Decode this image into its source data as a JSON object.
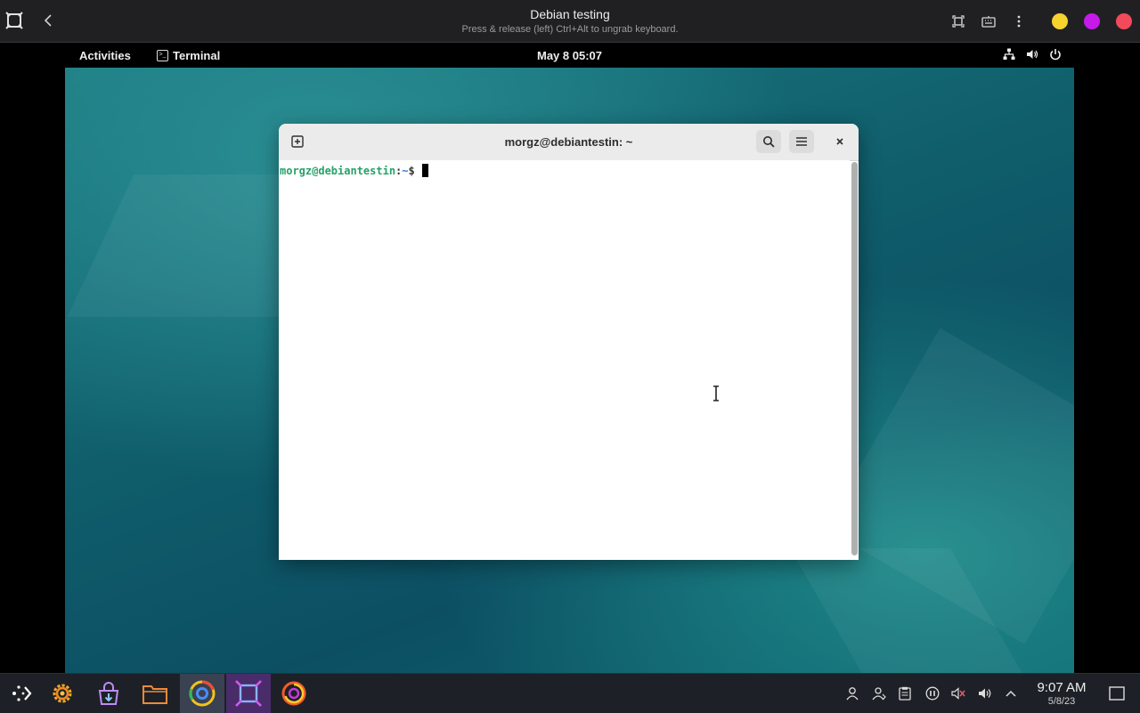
{
  "host": {
    "title": "Debian testing",
    "subtitle": "Press & release (left) Ctrl+Alt to ungrab keyboard.",
    "icons": {
      "app": "app-frame-icon",
      "back": "back-arrow-icon",
      "fit": "fit-window-icon",
      "keyboard": "keyboard-icon",
      "more": "more-vertical-icon"
    },
    "dots": [
      {
        "name": "yellow-dot",
        "color": "#f6d32d"
      },
      {
        "name": "purple-dot",
        "color": "#c61ae8"
      },
      {
        "name": "red-dot",
        "color": "#f24a5b"
      }
    ]
  },
  "guest_topbar": {
    "activities": "Activities",
    "app_name": "Terminal",
    "clock": "May 8  05:07",
    "icons": [
      "network-icon",
      "volume-icon",
      "power-icon"
    ]
  },
  "terminal": {
    "title": "morgz@debiantestin: ~",
    "prompt_user": "morgz@debiantestin",
    "prompt_sep": ":",
    "prompt_path": "~",
    "prompt_sign": "$ "
  },
  "taskbar": {
    "apps": [
      {
        "name": "app-launcher-icon"
      },
      {
        "name": "settings-icon"
      },
      {
        "name": "software-install-icon"
      },
      {
        "name": "files-icon"
      },
      {
        "name": "chrome-icon"
      },
      {
        "name": "vm-manager-icon"
      },
      {
        "name": "firefox-icon"
      }
    ],
    "time": "9:07 AM",
    "date": "5/8/23"
  },
  "colors": {
    "accent_green": "#26a269",
    "accent_blue": "#2a7bde",
    "taskbar_bg": "#1d2127"
  }
}
